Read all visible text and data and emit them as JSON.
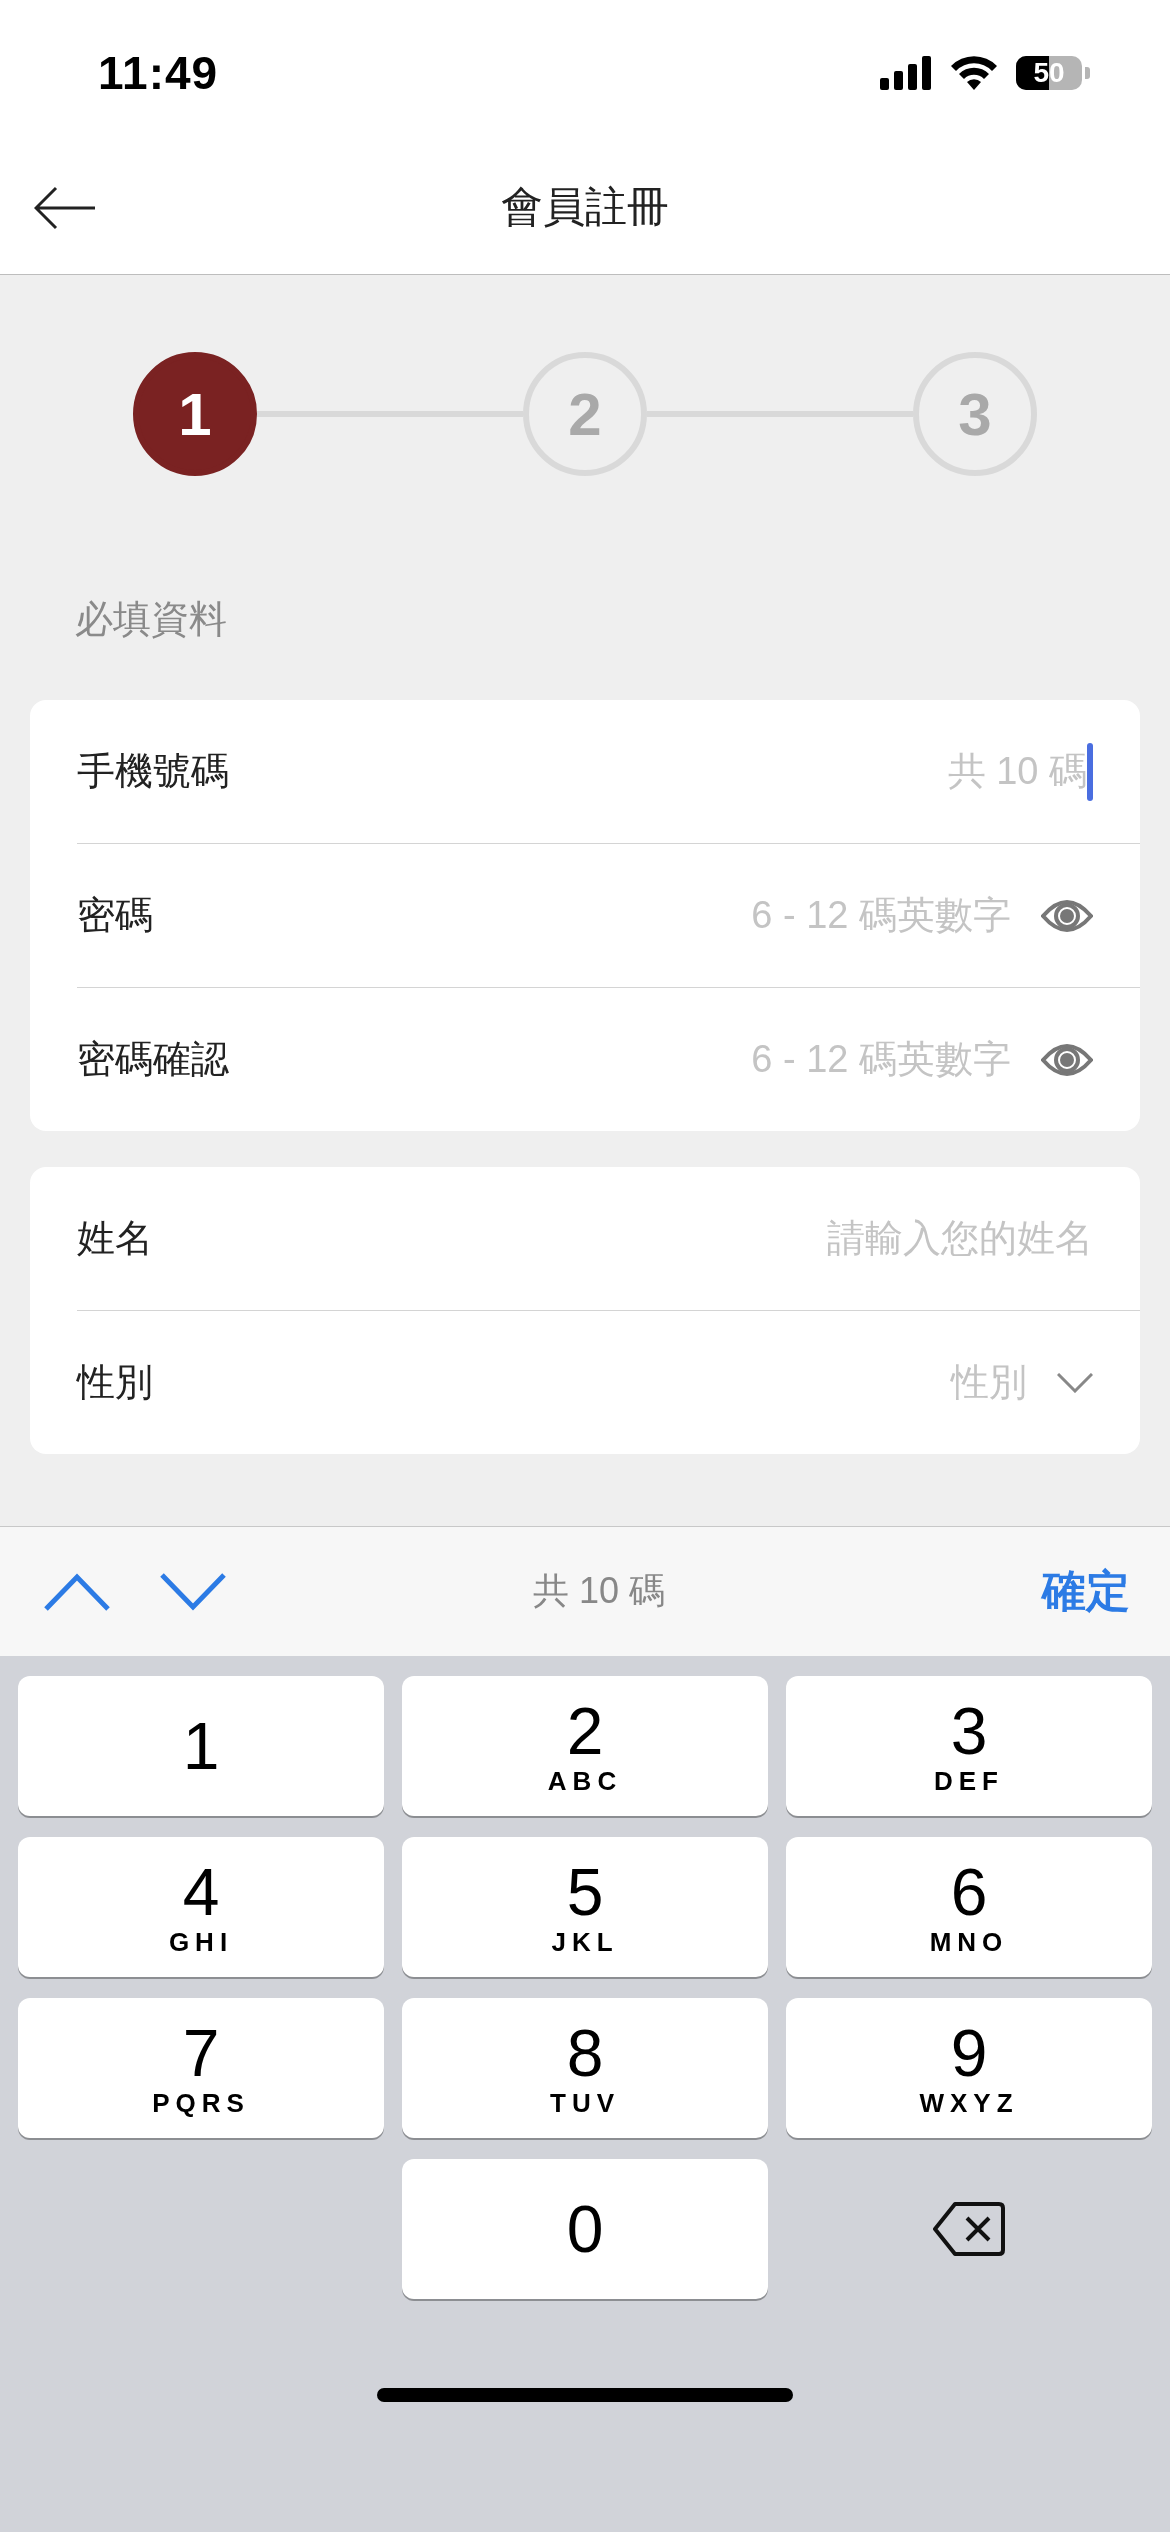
{
  "status_bar": {
    "time": "11:49",
    "battery": "50"
  },
  "header": {
    "title": "會員註冊"
  },
  "steps": [
    {
      "label": "1",
      "selected": true
    },
    {
      "label": "2",
      "selected": false
    },
    {
      "label": "3",
      "selected": false
    }
  ],
  "sections": [
    {
      "title": "必填資料",
      "fields": [
        {
          "kind": "text",
          "label": "手機號碼",
          "placeholder": "共 10 碼",
          "focused": true
        },
        {
          "kind": "password",
          "label": "密碼",
          "placeholder": "6 - 12 碼英數字",
          "focused": false
        },
        {
          "kind": "password",
          "label": "密碼確認",
          "placeholder": "6 - 12 碼英數字",
          "focused": false
        }
      ]
    },
    {
      "fields": [
        {
          "kind": "text",
          "label": "姓名",
          "placeholder": "請輸入您的姓名",
          "focused": false
        },
        {
          "kind": "select",
          "label": "性別",
          "placeholder": "性別",
          "focused": false
        }
      ]
    }
  ],
  "toolbar": {
    "hint": "共 10 碼",
    "done": "確定"
  },
  "keypad": [
    {
      "kind": "digit",
      "digit": "1"
    },
    {
      "kind": "digit",
      "digit": "2",
      "letters": "ABC"
    },
    {
      "kind": "digit",
      "digit": "3",
      "letters": "DEF"
    },
    {
      "kind": "digit",
      "digit": "4",
      "letters": "GHI"
    },
    {
      "kind": "digit",
      "digit": "5",
      "letters": "JKL"
    },
    {
      "kind": "digit",
      "digit": "6",
      "letters": "MNO"
    },
    {
      "kind": "digit",
      "digit": "7",
      "letters": "PQRS"
    },
    {
      "kind": "digit",
      "digit": "8",
      "letters": "TUV"
    },
    {
      "kind": "digit",
      "digit": "9",
      "letters": "WXYZ"
    },
    {
      "kind": "blank"
    },
    {
      "kind": "digit",
      "digit": "0"
    },
    {
      "kind": "delete"
    }
  ]
}
